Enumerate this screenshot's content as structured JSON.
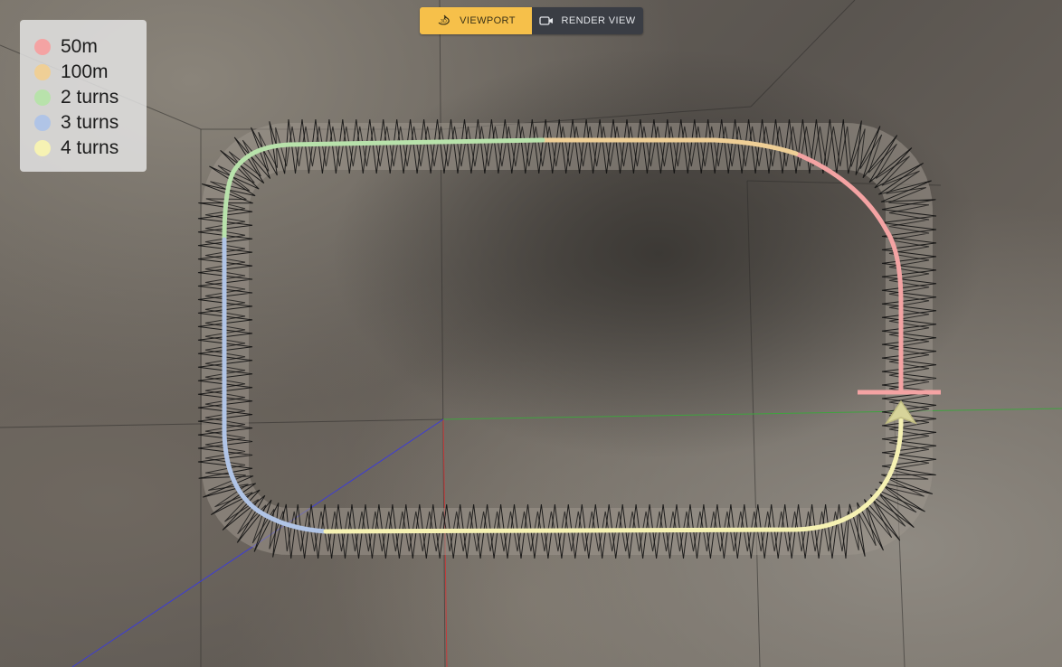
{
  "toolbar": {
    "viewport_label": "VIEWPORT",
    "viewport_icon": "3d-rotate-icon",
    "viewport_icon_text": "3D",
    "render_label": "RENDER VIEW",
    "render_icon": "video-camera-icon",
    "active": "viewport",
    "active_color": "#f6c04a",
    "inactive_color": "#3a3d44"
  },
  "legend": {
    "items": [
      {
        "label": "50m",
        "color": "#f4a3a3"
      },
      {
        "label": "100m",
        "color": "#efcf96"
      },
      {
        "label": "2 turns",
        "color": "#b8e2ab"
      },
      {
        "label": "3 turns",
        "color": "#b0c4e6"
      },
      {
        "label": "4 turns",
        "color": "#f6f2b3"
      }
    ]
  },
  "scene": {
    "axes": {
      "x_color": "#3fa33f",
      "y_color": "#c43b3b",
      "z_color": "#3c3cd6"
    },
    "track_color": "#111111"
  }
}
